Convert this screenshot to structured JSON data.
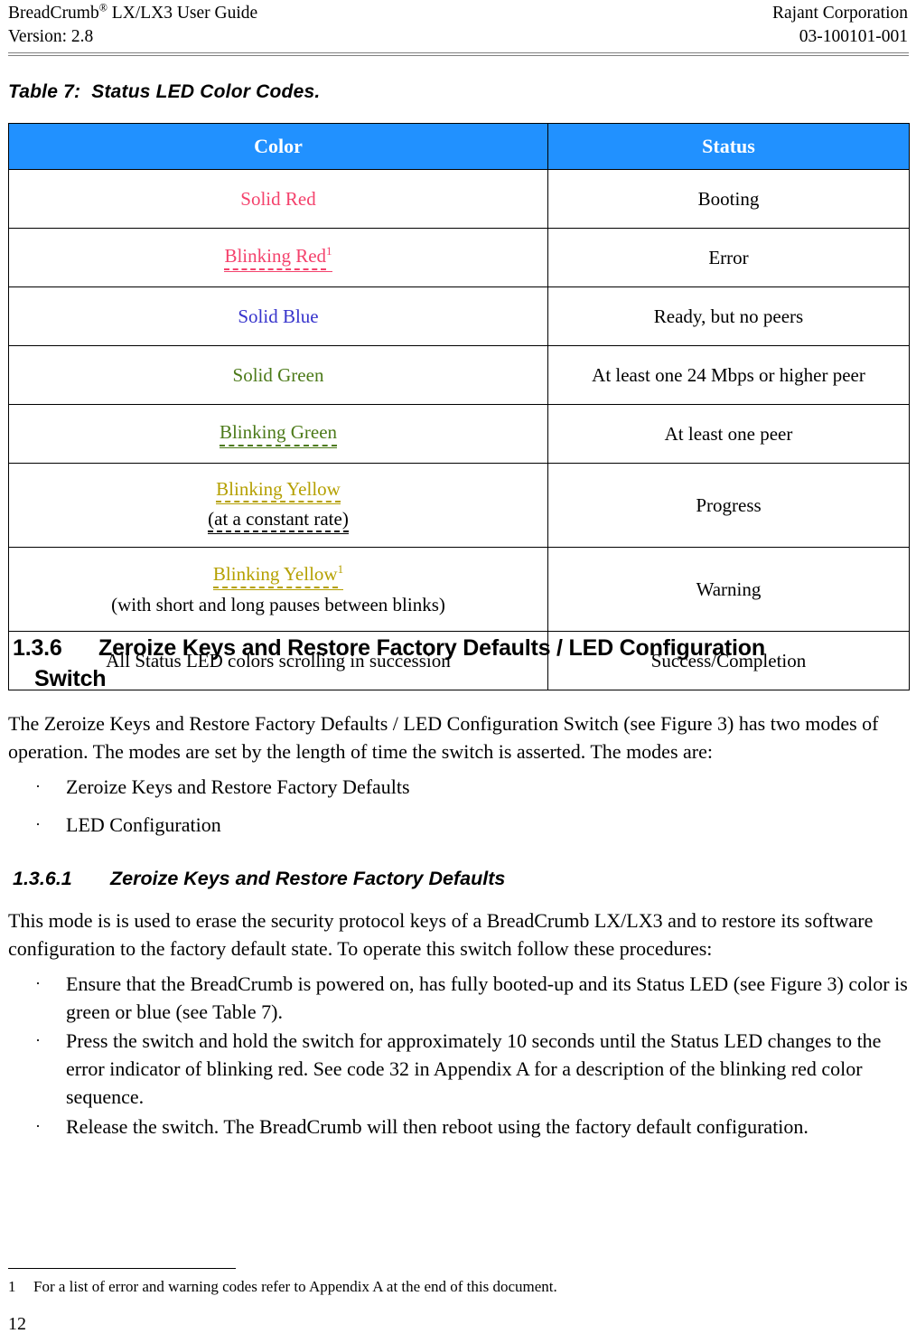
{
  "header": {
    "left_line1_pre": "BreadCrumb",
    "left_line1_sup": "®",
    "left_line1_post": " LX/LX3 User Guide",
    "left_line2": "Version:  2.8",
    "right_line1": "Rajant Corporation",
    "right_line2": "03-100101-001"
  },
  "table": {
    "caption": "Table 7:  Status LED Color Codes.",
    "header_accent": "#2191FF",
    "columns": [
      "Color",
      "Status"
    ],
    "rows": [
      {
        "color_text": "Solid Red",
        "color_hex": "#F4426C",
        "underline": "none",
        "footnote_marker": "",
        "note": "",
        "status": "Booting"
      },
      {
        "color_text": "Blinking Red",
        "color_hex": "#F4426C",
        "underline": "both",
        "footnote_marker": "1",
        "note": "",
        "status": "Error"
      },
      {
        "color_text": "Solid Blue",
        "color_hex": "#3633CC",
        "underline": "none",
        "footnote_marker": "",
        "note": "",
        "status": "Ready, but no peers"
      },
      {
        "color_text": "Solid Green",
        "color_hex": "#4C7A19",
        "underline": "none",
        "footnote_marker": "",
        "note": "",
        "status": "At least one 24 Mbps or higher peer"
      },
      {
        "color_text": "Blinking Green",
        "color_hex": "#4C7A19",
        "underline": "both",
        "footnote_marker": "",
        "note": "",
        "status": "At least one peer"
      },
      {
        "color_text": "Blinking Yellow",
        "color_hex": "#B5A000",
        "underline": "both",
        "footnote_marker": "",
        "note": "(at a constant rate)",
        "note_underline": "both",
        "status": "Progress"
      },
      {
        "color_text": "Blinking Yellow",
        "color_hex": "#B5A000",
        "underline": "both",
        "footnote_marker": "1",
        "note": "(with short and long pauses between blinks)",
        "note_underline": "none",
        "status": "Warning"
      },
      {
        "color_text": "All Status LED colors scrolling in succession",
        "color_hex": "#000000",
        "underline": "none",
        "footnote_marker": "",
        "note": "",
        "status": "Success/Completion"
      }
    ]
  },
  "section": {
    "number": "1.3.6",
    "title_line1": "Zeroize Keys and Restore Factory Defaults / LED Configuration",
    "title_line2": "Switch",
    "paragraph": "The Zeroize Keys and Restore Factory Defaults / LED Configuration Switch (see Figure 3) has two modes of operation.  The modes are set by the length of time the switch is asserted. The modes are:",
    "bullets": [
      "Zeroize Keys and Restore Factory Defaults",
      "LED Configuration"
    ]
  },
  "subsection": {
    "number": "1.3.6.1",
    "title": "Zeroize Keys and Restore Factory Defaults",
    "paragraph": "This mode is is used to erase the security protocol keys of a BreadCrumb LX/LX3 and to restore its software configuration to the factory default state.  To operate this switch follow these procedures:",
    "bullets": [
      "Ensure that the BreadCrumb is powered on, has fully booted-up and its Status LED (see Figure 3) color is green or blue (see Table 7).",
      "Press the switch and hold the switch for approximately 10 seconds until the Status LED changes to the error indicator of blinking red.  See code 32 in Appendix A for a description of the blinking red color sequence.",
      "Release the switch. The BreadCrumb will then reboot using the factory default configuration."
    ]
  },
  "footnote": {
    "number": "1",
    "text": "For a list of error and warning codes refer to Appendix A at the end of this document."
  },
  "page_number": "12",
  "bullet_glyph": "·"
}
